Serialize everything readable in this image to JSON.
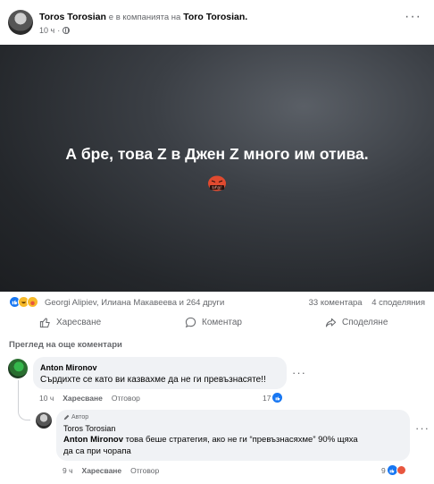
{
  "post": {
    "author": "Toros Torosian",
    "company_text": "е в компанията на",
    "company_author": "Toro Torosian.",
    "time": "10 ч",
    "more": "···",
    "image_text": "А бре, това Z в Джен Z много им отива.",
    "image_emoji": "rage-emoji"
  },
  "stats": {
    "reaction_names": "Georgi Alipiev, Илиана Макавеева и 264 други",
    "comments": "33 коментара",
    "shares": "4 споделяния"
  },
  "actions": {
    "like": "Харесване",
    "comment": "Коментар",
    "share": "Споделяне"
  },
  "more_comments": "Преглед на още коментари",
  "comments": [
    {
      "author": "Anton Mironov",
      "text": "Сърдихте се като ви казвахме да не ги превъзнасяте!!",
      "time": "10 ч",
      "like": "Харесване",
      "reply": "Отговор",
      "reactions": "17"
    },
    {
      "badge": "Автор",
      "author": "Toros Torosian",
      "mention": "Anton Mironov",
      "text_line1": " това беше стратегия, ако не ги “превъзнасяхме” 90% щяха",
      "text_line2": "да са при чорапа",
      "time": "9 ч",
      "like": "Харесване",
      "reply": "Отговор",
      "reactions": "9"
    }
  ],
  "colors": {
    "accent": "#1877f2",
    "muted": "#65676b",
    "bubble": "#f0f2f5"
  }
}
